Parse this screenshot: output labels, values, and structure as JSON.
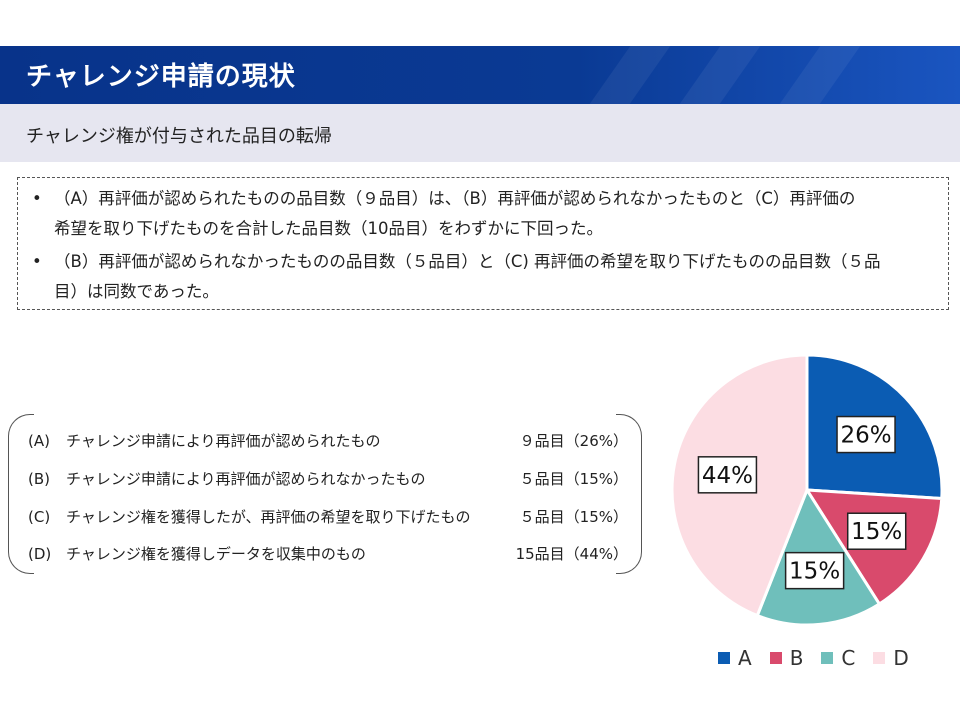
{
  "header": {
    "title": "チャレンジ申請の現状",
    "subtitle": "チャレンジ権が付与された品目の転帰"
  },
  "notes": [
    {
      "bullet": "•",
      "line1": "（A）再評価が認められたものの品目数（９品目）は、（B）再評価が認められなかったものと（C）再評価の",
      "line2": "希望を取り下げたものを合計した品目数（10品目）をわずかに下回った。"
    },
    {
      "bullet": "•",
      "line1": "（B）再評価が認められなかったものの品目数（５品目）と（C) 再評価の希望を取り下げたものの品目数（５品",
      "line2": "目）は同数であった。"
    }
  ],
  "legend_rows": [
    {
      "code": "(A)",
      "desc": "チャレンジ申請により再評価が認められたもの",
      "count": "９品目（26%）"
    },
    {
      "code": "(B)",
      "desc": "チャレンジ申請により再評価が認められなかったもの",
      "count": "５品目（15%）"
    },
    {
      "code": "(C)",
      "desc": "チャレンジ権を獲得したが、再評価の希望を取り下げたもの",
      "count": "５品目（15%）"
    },
    {
      "code": "(D)",
      "desc": "チャレンジ権を獲得しデータを収集中のもの",
      "count": "15品目（44%）"
    }
  ],
  "chart_data": {
    "type": "pie",
    "categories": [
      "A",
      "B",
      "C",
      "D"
    ],
    "values": [
      26,
      15,
      15,
      44
    ],
    "labels": [
      "26%",
      "15%",
      "15%",
      "44%"
    ],
    "colors": [
      "#0b5cb3",
      "#d94a6c",
      "#6fbfbb",
      "#fcdde3"
    ],
    "legend_position": "bottom"
  }
}
